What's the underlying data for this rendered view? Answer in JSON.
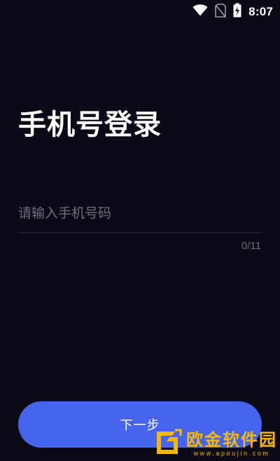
{
  "status_bar": {
    "time": "8:07",
    "icons": [
      "wifi-icon",
      "no-sim-icon",
      "battery-charging-icon"
    ]
  },
  "login": {
    "title": "手机号登录",
    "phone_placeholder": "请输入手机号码",
    "phone_value": "",
    "char_counter": "0/11",
    "next_button_label": "下一步"
  },
  "watermark": {
    "name": "欧金软件园",
    "url": "www.apoujin.com"
  },
  "colors": {
    "background": "#0a0b17",
    "accent": "#4664ee",
    "placeholder": "#6c6f7b",
    "watermark": "#f5b80a"
  }
}
